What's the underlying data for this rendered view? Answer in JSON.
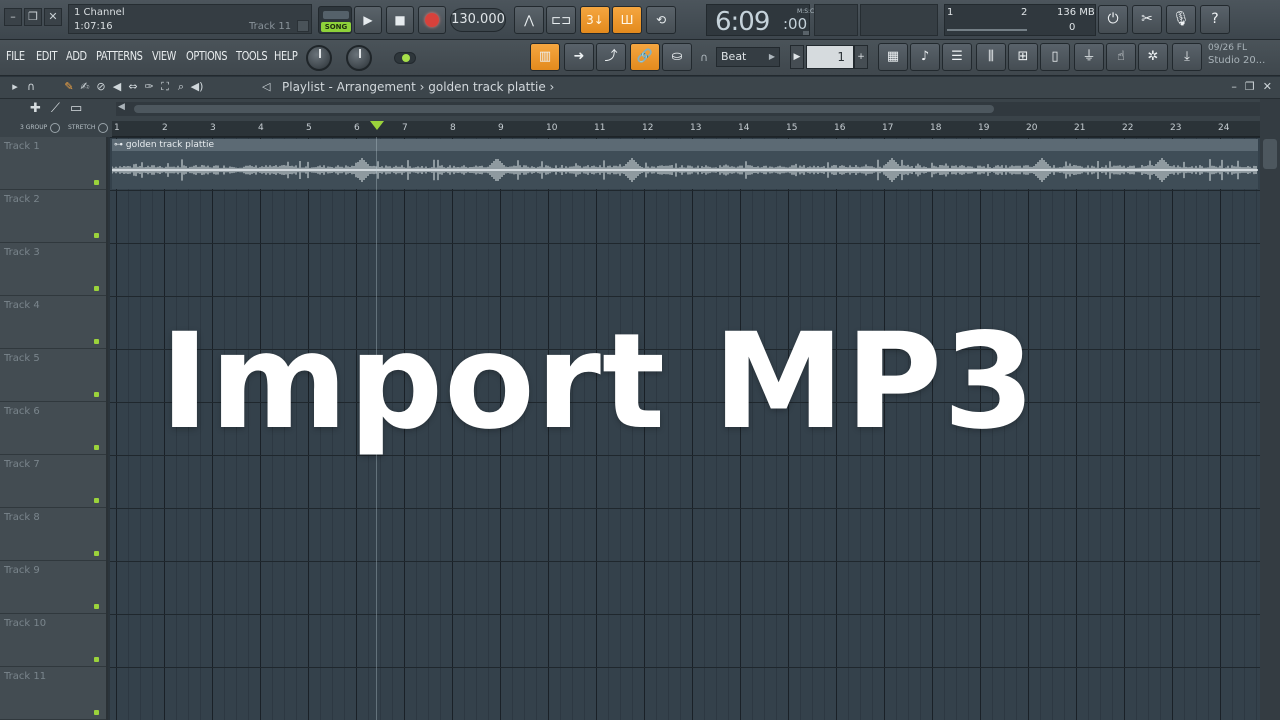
{
  "window_buttons": [
    "–",
    "❐",
    "✕"
  ],
  "hint_panel": {
    "line1": "1 Channel",
    "line2": "1:07:16",
    "track": "Track 11"
  },
  "transport": {
    "mode_label": "SONG",
    "play_icon": "play-icon",
    "stop_icon": "stop-icon",
    "record_icon": "record-icon",
    "tempo": "130.000"
  },
  "time_display": {
    "main": "6:09",
    "sub": ":00",
    "unit": "M:S:CS"
  },
  "cpu_panel": {
    "a": "1",
    "b": "2",
    "c": "136 MB",
    "d": "0"
  },
  "top_right_icons": [
    "reset-icon",
    "cut-icon",
    "mic-icon",
    "help-icon"
  ],
  "menu": [
    "FILE",
    "EDIT",
    "ADD",
    "PATTERNS",
    "VIEW",
    "OPTIONS",
    "TOOLS",
    "HELP"
  ],
  "snap": {
    "value": "Beat"
  },
  "step": {
    "value": "1"
  },
  "news": {
    "line1": "09/26  FL",
    "line2": "Studio 20..."
  },
  "playlist": {
    "breadcrumb": "Playlist - Arrangement › golden track plattie ›",
    "group_label_1": "3 GROUP",
    "group_label_2": "STRETCH"
  },
  "ruler": [
    "1",
    "2",
    "3",
    "4",
    "5",
    "6",
    "7",
    "8",
    "9",
    "10",
    "11",
    "12",
    "13",
    "14",
    "15",
    "16",
    "17",
    "18",
    "19",
    "20",
    "21",
    "22",
    "23",
    "24"
  ],
  "tracks": [
    "Track 1",
    "Track 2",
    "Track 3",
    "Track 4",
    "Track 5",
    "Track 6",
    "Track 7",
    "Track 8",
    "Track 9",
    "Track 10",
    "Track 11"
  ],
  "clip": {
    "name": "golden track plattie"
  },
  "overlay_title": "Import MP3",
  "colors": {
    "accent_orange": "#f5a640",
    "accent_green": "#9bd33b",
    "record_red": "#d8413b"
  }
}
